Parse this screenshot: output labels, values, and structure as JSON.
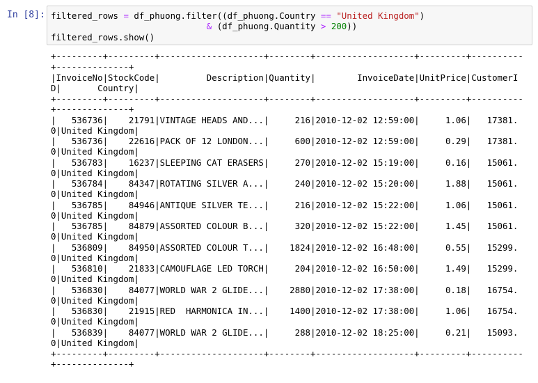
{
  "prompt": "In [8]:",
  "code": {
    "line1": {
      "a": "filtered_rows ",
      "eq": "=",
      "b": " df_phuong.filter((df_phuong.Country ",
      "op": "==",
      "sp": " ",
      "str": "\"United Kingdom\"",
      "c": ")"
    },
    "line2": {
      "indent": "                              ",
      "amp": "&",
      "a": " (df_phuong.Quantity ",
      "gt": ">",
      "sp": " ",
      "num": "200",
      "b": "))"
    },
    "line3": "filtered_rows.show()"
  },
  "output": {
    "lines": [
      "+---------+---------+--------------------+--------+-------------------+---------+----------",
      "+--------------+",
      "|InvoiceNo|StockCode|         Description|Quantity|        InvoiceDate|UnitPrice|CustomerI",
      "D|       Country|",
      "+---------+---------+--------------------+--------+-------------------+---------+----------",
      "+--------------+",
      "|   536736|    21791|VINTAGE HEADS AND...|     216|2010-12-02 12:59:00|     1.06|   17381.",
      "0|United Kingdom|",
      "|   536736|    22616|PACK OF 12 LONDON...|     600|2010-12-02 12:59:00|     0.29|   17381.",
      "0|United Kingdom|",
      "|   536783|    16237|SLEEPING CAT ERASERS|     270|2010-12-02 15:19:00|     0.16|   15061.",
      "0|United Kingdom|",
      "|   536784|    84347|ROTATING SILVER A...|     240|2010-12-02 15:20:00|     1.88|   15061.",
      "0|United Kingdom|",
      "|   536785|    84946|ANTIQUE SILVER TE...|     216|2010-12-02 15:22:00|     1.06|   15061.",
      "0|United Kingdom|",
      "|   536785|    84879|ASSORTED COLOUR B...|     320|2010-12-02 15:22:00|     1.45|   15061.",
      "0|United Kingdom|",
      "|   536809|    84950|ASSORTED COLOUR T...|    1824|2010-12-02 16:48:00|     0.55|   15299.",
      "0|United Kingdom|",
      "|   536810|    21833|CAMOUFLAGE LED TORCH|     204|2010-12-02 16:50:00|     1.49|   15299.",
      "0|United Kingdom|",
      "|   536830|    84077|WORLD WAR 2 GLIDE...|    2880|2010-12-02 17:38:00|     0.18|   16754.",
      "0|United Kingdom|",
      "|   536830|    21915|RED  HARMONICA IN...|    1400|2010-12-02 17:38:00|     1.06|   16754.",
      "0|United Kingdom|",
      "|   536839|    84077|WORLD WAR 2 GLIDE...|     288|2010-12-02 18:25:00|     0.21|   15093.",
      "0|United Kingdom|",
      "+---------+---------+--------------------+--------+-------------------+---------+----------",
      "+--------------+"
    ]
  }
}
